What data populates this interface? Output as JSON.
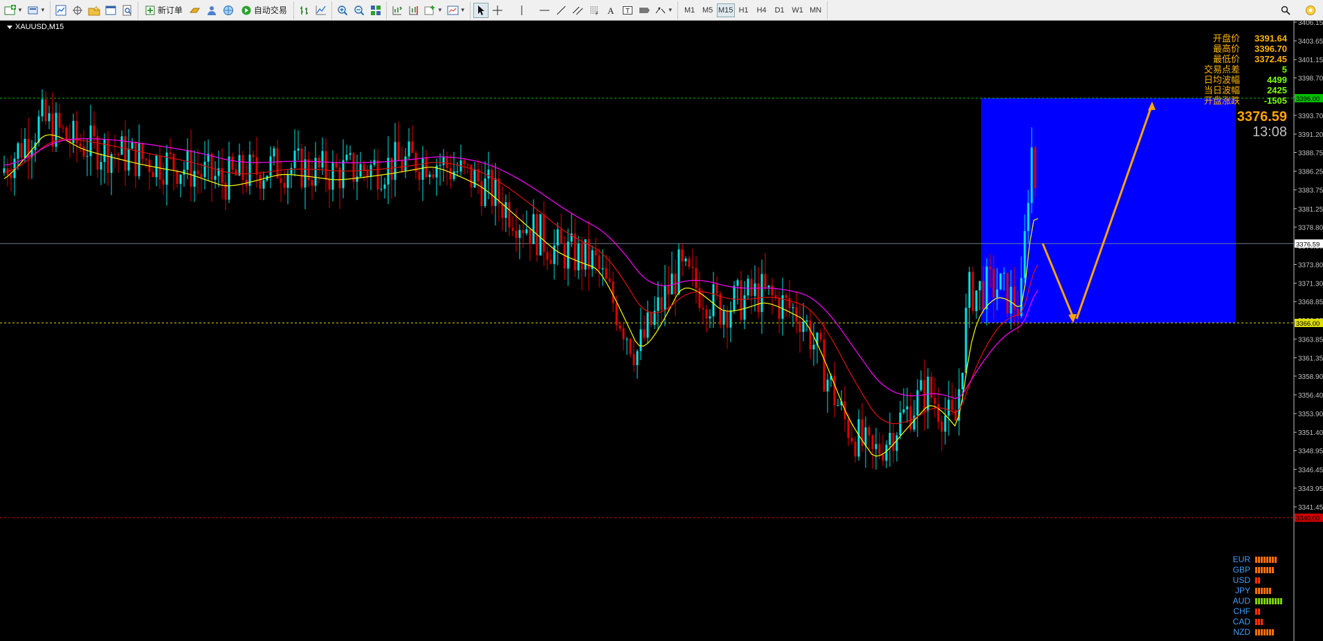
{
  "toolbar": {
    "new_order_label": "新订单",
    "auto_trade_label": "自动交易",
    "timeframes": [
      "M1",
      "M5",
      "M15",
      "H1",
      "H4",
      "D1",
      "W1",
      "MN"
    ],
    "active_timeframe": "M15"
  },
  "chart": {
    "symbol": "XAUUSD,M15",
    "current_price": "3376.59",
    "countdown": "13:08",
    "price_axis": {
      "ticks": [
        "3406.15",
        "3403.65",
        "3401.15",
        "3398.70",
        "3396.20",
        "3393.70",
        "3391.20",
        "3388.75",
        "3386.25",
        "3383.75",
        "3381.25",
        "3378.80",
        "3376.30",
        "3373.80",
        "3371.30",
        "3368.85",
        "3366.35",
        "3363.85",
        "3361.35",
        "3358.90",
        "3356.40",
        "3353.90",
        "3351.40",
        "3348.95",
        "3346.45",
        "3343.95",
        "3341.45"
      ],
      "range": [
        3340.0,
        3407.0
      ]
    },
    "horizontal_lines": [
      {
        "price": 3396.0,
        "label": "3396.00",
        "color": "#00c000"
      },
      {
        "price": 3376.59,
        "label": "3376.59",
        "color": "#708090"
      },
      {
        "price": 3366.0,
        "label": "3366.00",
        "color": "#e0e000"
      },
      {
        "price": 3340.0,
        "label": "3340.00",
        "color": "#d00000"
      }
    ],
    "colors": {
      "bull_candle": "#00e5e5",
      "bear_candle": "#e00000",
      "ma_fast": "#ffff00",
      "ma_mid": "#e01010",
      "ma_slow": "#ff00ff",
      "zone": "#0000ff",
      "arrow": "#ffa500"
    },
    "zone": {
      "price_top": 3396.0,
      "price_bottom": 3366.0
    },
    "projection": {
      "low_price": 3366.0,
      "high_price": 3395.0
    }
  },
  "info_panel": [
    {
      "label": "开盘价",
      "value": "3391.64",
      "tone": "orange"
    },
    {
      "label": "最高价",
      "value": "3396.70",
      "tone": "orange"
    },
    {
      "label": "最低价",
      "value": "3372.45",
      "tone": "orange"
    },
    {
      "label": "交易点差",
      "value": "5",
      "tone": "green"
    },
    {
      "label": "日均波幅",
      "value": "4499",
      "tone": "green"
    },
    {
      "label": "当日波幅",
      "value": "2425",
      "tone": "green"
    },
    {
      "label": "开盘涨跌",
      "value": "-1505",
      "tone": "green"
    }
  ],
  "currency_strength": [
    {
      "name": "EUR",
      "level": 8,
      "color": "#ff7000"
    },
    {
      "name": "GBP",
      "level": 7,
      "color": "#ff7000"
    },
    {
      "name": "USD",
      "level": 2,
      "color": "#ff3000"
    },
    {
      "name": "JPY",
      "level": 6,
      "color": "#ff7000"
    },
    {
      "name": "AUD",
      "level": 10,
      "color": "#7fd000"
    },
    {
      "name": "CHF",
      "level": 2,
      "color": "#ff3000"
    },
    {
      "name": "CAD",
      "level": 3,
      "color": "#ff3000"
    },
    {
      "name": "NZD",
      "level": 7,
      "color": "#ff7000"
    }
  ]
}
